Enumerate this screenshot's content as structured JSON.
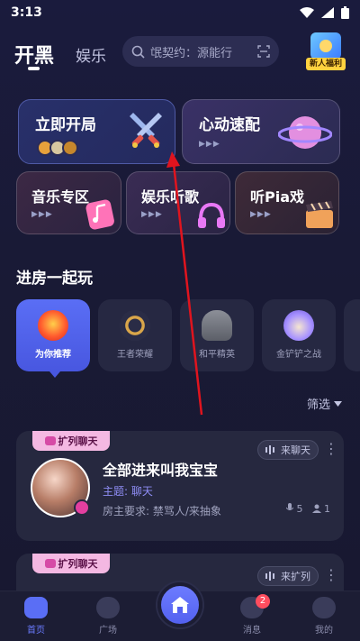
{
  "status": {
    "time": "3:13"
  },
  "header": {
    "tab_main": "开黑",
    "tab_second": "娱乐",
    "search_text": "氓契约：源能行",
    "newbie_label": "新人福利"
  },
  "cards": {
    "start": {
      "title": "立即开局"
    },
    "match": {
      "title": "心动速配",
      "dots": "▶▶▶"
    },
    "music": {
      "title": "音乐专区",
      "dots": "▶▶▶"
    },
    "listen": {
      "title": "娱乐听歌",
      "dots": "▶▶▶"
    },
    "pia": {
      "title": "听Pia戏",
      "dots": "▶▶▶"
    }
  },
  "section": {
    "title": "进房一起玩"
  },
  "games": [
    {
      "label": "为你推荐"
    },
    {
      "label": "王者荣耀"
    },
    {
      "label": "和平精英"
    },
    {
      "label": "金铲铲之战"
    }
  ],
  "filter": {
    "label": "筛选"
  },
  "rooms": [
    {
      "badge": "扩列聊天",
      "title": "全部进来叫我宝宝",
      "topic": "主题: 聊天",
      "requirement": "房主要求: 禁骂人/来抽象",
      "pill": "来聊天",
      "mic_count": "5",
      "user_count": "1"
    },
    {
      "badge": "扩列聊天",
      "pill": "来扩列"
    }
  ],
  "tabbar": {
    "home": "首页",
    "plaza": "广场",
    "messages": "消息",
    "me": "我的",
    "message_count": "2"
  },
  "colors": {
    "accent": "#5a6ef5",
    "annotation": "#e0141e"
  }
}
